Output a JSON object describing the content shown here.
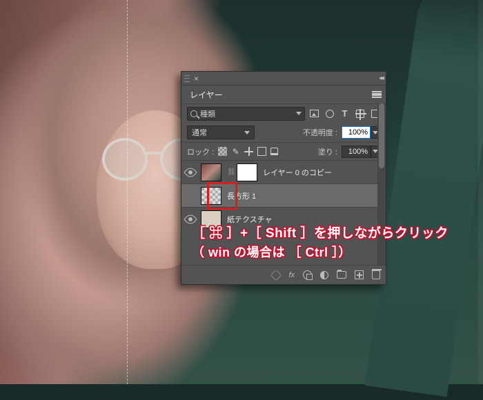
{
  "panel": {
    "title": "レイヤー",
    "search_label": "種類",
    "blend_mode": "通常",
    "opacity_label": "不透明度 :",
    "opacity_value": "100%",
    "lock_label": "ロック :",
    "fill_label": "塗り :",
    "fill_value": "100%",
    "layers": [
      {
        "name": "レイヤー 0 のコピー"
      },
      {
        "name": "長方形 1"
      },
      {
        "name": "紙テクスチャ"
      }
    ],
    "fx_label": "fx"
  },
  "callout": {
    "line1": "［ ⌘ ］+［ Shift ］を押しながらクリック",
    "line2": "（ win の場合は ［ Ctrl ］）"
  }
}
